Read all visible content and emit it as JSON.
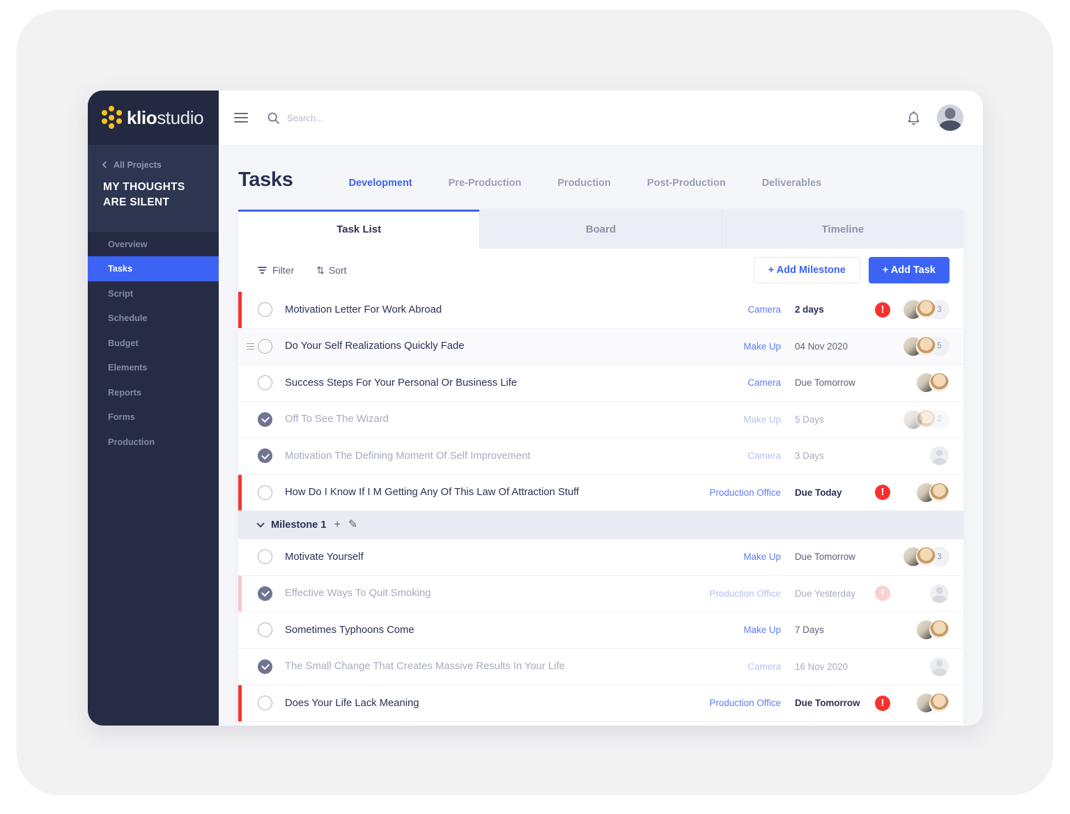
{
  "brand": {
    "name_bold": "klio",
    "name_light": "studio",
    "logo_color": "#fcc21b"
  },
  "sidebar": {
    "back_label": "All Projects",
    "project_title": "MY THOUGHTS ARE SILENT",
    "items": [
      {
        "label": "Overview",
        "active": false
      },
      {
        "label": "Tasks",
        "active": true
      },
      {
        "label": "Script",
        "active": false
      },
      {
        "label": "Schedule",
        "active": false
      },
      {
        "label": "Budget",
        "active": false
      },
      {
        "label": "Elements",
        "active": false
      },
      {
        "label": "Reports",
        "active": false
      },
      {
        "label": "Forms",
        "active": false
      },
      {
        "label": "Production",
        "active": false
      }
    ]
  },
  "topbar": {
    "menu_icon": "hamburger-icon",
    "search_placeholder": "Search...",
    "search_value": "",
    "bell_icon": "bell-icon",
    "avatar": "user-avatar"
  },
  "page": {
    "title": "Tasks",
    "phase_tabs": [
      {
        "label": "Development",
        "active": true
      },
      {
        "label": "Pre-Production",
        "active": false
      },
      {
        "label": "Production",
        "active": false
      },
      {
        "label": "Post-Production",
        "active": false
      },
      {
        "label": "Deliverables",
        "active": false
      }
    ],
    "view_tabs": [
      {
        "label": "Task List",
        "active": true
      },
      {
        "label": "Board",
        "active": false
      },
      {
        "label": "Timeline",
        "active": false
      }
    ]
  },
  "toolbar": {
    "filter_label": "Filter",
    "sort_label": "Sort",
    "add_milestone_label": "+ Add Milestone",
    "add_task_label": "+ Add Task",
    "accent_color": "#3d63f5"
  },
  "milestone": {
    "label": "Milestone 1",
    "add_icon": "plus-icon",
    "edit_icon": "pencil-icon"
  },
  "rows": [
    {
      "name": "Motivation Letter For Work Abroad",
      "dept": "Camera",
      "due": "2 days",
      "due_bold": true,
      "done": false,
      "alert": "solid",
      "avatars": 2,
      "count": "3",
      "edge": "#f8312f",
      "alt": false,
      "drag": false
    },
    {
      "name": "Do Your Self Realizations Quickly Fade",
      "dept": "Make Up",
      "due": "04 Nov 2020",
      "due_bold": false,
      "done": false,
      "alert": "none",
      "avatars": 2,
      "count": "5",
      "edge": "none",
      "alt": true,
      "drag": true
    },
    {
      "name": "Success Steps For Your Personal Or Business Life",
      "dept": "Camera",
      "due": "Due Tomorrow",
      "due_bold": false,
      "done": false,
      "alert": "none",
      "avatars": 2,
      "count": "",
      "edge": "none",
      "alt": false,
      "drag": false
    },
    {
      "name": "Off To See The Wizard",
      "dept": "Make Up",
      "due": "5 Days",
      "due_bold": false,
      "done": true,
      "alert": "none",
      "avatars": 2,
      "count": "2",
      "edge": "none",
      "alt": false,
      "drag": false
    },
    {
      "name": "Motivation The Defining Moment Of Self Improvement",
      "dept": "Camera",
      "due": "3 Days",
      "due_bold": false,
      "done": true,
      "alert": "none",
      "avatars": 1,
      "count": "",
      "edge": "none",
      "alt": false,
      "drag": false
    },
    {
      "name": "How Do I Know If I M Getting Any Of This Law Of Attraction Stuff",
      "dept": "Production Office",
      "due": "Due Today",
      "due_bold": true,
      "done": false,
      "alert": "solid",
      "avatars": 2,
      "count": "",
      "edge": "#f8312f",
      "alt": false,
      "drag": false
    },
    {
      "name": "Motivate Yourself",
      "dept": "Make Up",
      "due": "Due Tomorrow",
      "due_bold": false,
      "done": false,
      "alert": "none",
      "avatars": 2,
      "count": "3",
      "edge": "none",
      "alt": false,
      "drag": false
    },
    {
      "name": "Effective Ways To Quit Smoking",
      "dept": "Production Office",
      "due": "Due Yesterday",
      "due_bold": true,
      "done": true,
      "alert": "faded",
      "avatars": 1,
      "count": "",
      "edge": "#fbc4c4",
      "alt": false,
      "drag": false
    },
    {
      "name": "Sometimes Typhoons Come",
      "dept": "Make Up",
      "due": "7 Days",
      "due_bold": false,
      "done": false,
      "alert": "none",
      "avatars": 2,
      "count": "",
      "edge": "none",
      "alt": false,
      "drag": false
    },
    {
      "name": "The Small Change That Creates Massive Results In Your Life",
      "dept": "Camera",
      "due": "16 Nov 2020",
      "due_bold": false,
      "done": true,
      "alert": "none",
      "avatars": 1,
      "count": "",
      "edge": "none",
      "alt": false,
      "drag": false
    },
    {
      "name": "Does Your Life Lack Meaning",
      "dept": "Production Office",
      "due": "Due Tomorrow",
      "due_bold": true,
      "done": false,
      "alert": "solid",
      "avatars": 2,
      "count": "",
      "edge": "#f8312f",
      "alt": false,
      "drag": false
    }
  ],
  "milestone_after_row_index": 5,
  "alert_glyph": "!"
}
